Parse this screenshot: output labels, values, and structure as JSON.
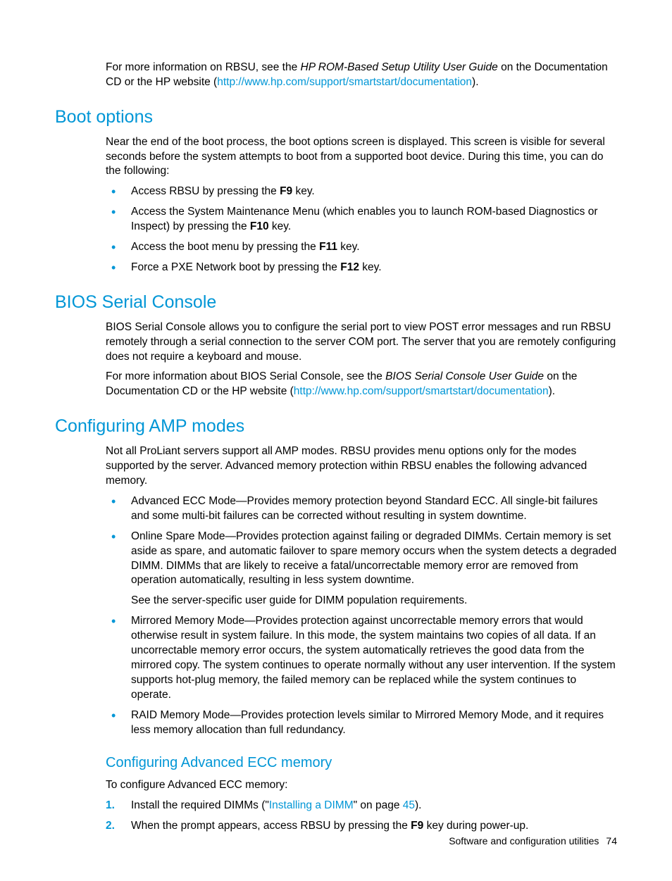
{
  "intro": {
    "p1a": "For more information on RBSU, see the ",
    "p1b_ital": "HP ROM-Based Setup Utility User Guide",
    "p1c": " on the Documentation CD or the HP website (",
    "p1_link": "http://www.hp.com/support/smartstart/documentation",
    "p1d": ")."
  },
  "boot": {
    "heading": "Boot options",
    "p1": "Near the end of the boot process, the boot options screen is displayed. This screen is visible for several seconds before the system attempts to boot from a supported boot device. During this time, you can do the following:",
    "li1a": "Access RBSU by pressing the ",
    "li1b": "F9",
    "li1c": " key.",
    "li2a": "Access the System Maintenance Menu (which enables you to launch ROM-based Diagnostics or Inspect) by pressing the ",
    "li2b": "F10",
    "li2c": " key.",
    "li3a": "Access the boot menu by pressing the ",
    "li3b": "F11",
    "li3c": " key.",
    "li4a": "Force a PXE Network boot by pressing the ",
    "li4b": "F12",
    "li4c": " key."
  },
  "bios": {
    "heading": "BIOS Serial Console",
    "p1": "BIOS Serial Console allows you to configure the serial port to view POST error messages and run RBSU remotely through a serial connection to the server COM port. The server that you are remotely configuring does not require a keyboard and mouse.",
    "p2a": "For more information about BIOS Serial Console, see the ",
    "p2b_ital": "BIOS Serial Console User Guide",
    "p2c": " on the Documentation CD or the HP website (",
    "p2_link": "http://www.hp.com/support/smartstart/documentation",
    "p2d": ")."
  },
  "amp": {
    "heading": "Configuring AMP modes",
    "p1": "Not all ProLiant servers support all AMP modes. RBSU provides menu options only for the modes supported by the server. Advanced memory protection within RBSU enables the following advanced memory.",
    "li1": "Advanced ECC Mode—Provides memory protection beyond Standard ECC. All single-bit failures and some multi-bit failures can be corrected without resulting in system downtime.",
    "li2": "Online Spare Mode—Provides protection against failing or degraded DIMMs. Certain memory is set aside as spare, and automatic failover to spare memory occurs when the system detects a degraded DIMM. DIMMs that are likely to receive a fatal/uncorrectable memory error are removed from operation automatically, resulting in less system downtime.",
    "li2_sub": "See the server-specific user guide for DIMM population requirements.",
    "li3": "Mirrored Memory Mode—Provides protection against uncorrectable memory errors that would otherwise result in system failure. In this mode, the system maintains two copies of all data. If an uncorrectable memory error occurs, the system automatically retrieves the good data from the mirrored copy. The system continues to operate normally without any user intervention. If the system supports hot-plug memory, the failed memory can be replaced while the system continues to operate.",
    "li4": "RAID Memory Mode—Provides protection levels similar to Mirrored Memory Mode, and it requires less memory allocation than full redundancy."
  },
  "ecc": {
    "heading": "Configuring Advanced ECC memory",
    "p1": "To configure Advanced ECC memory:",
    "li1a": "Install the required DIMMs (\"",
    "li1_link": "Installing a DIMM",
    "li1b": "\" on page ",
    "li1_page": "45",
    "li1c": ").",
    "li2a": "When the prompt appears, access RBSU by pressing the ",
    "li2b": "F9",
    "li2c": " key during power-up."
  },
  "footer": {
    "section": "Software and configuration utilities",
    "page": "74"
  }
}
